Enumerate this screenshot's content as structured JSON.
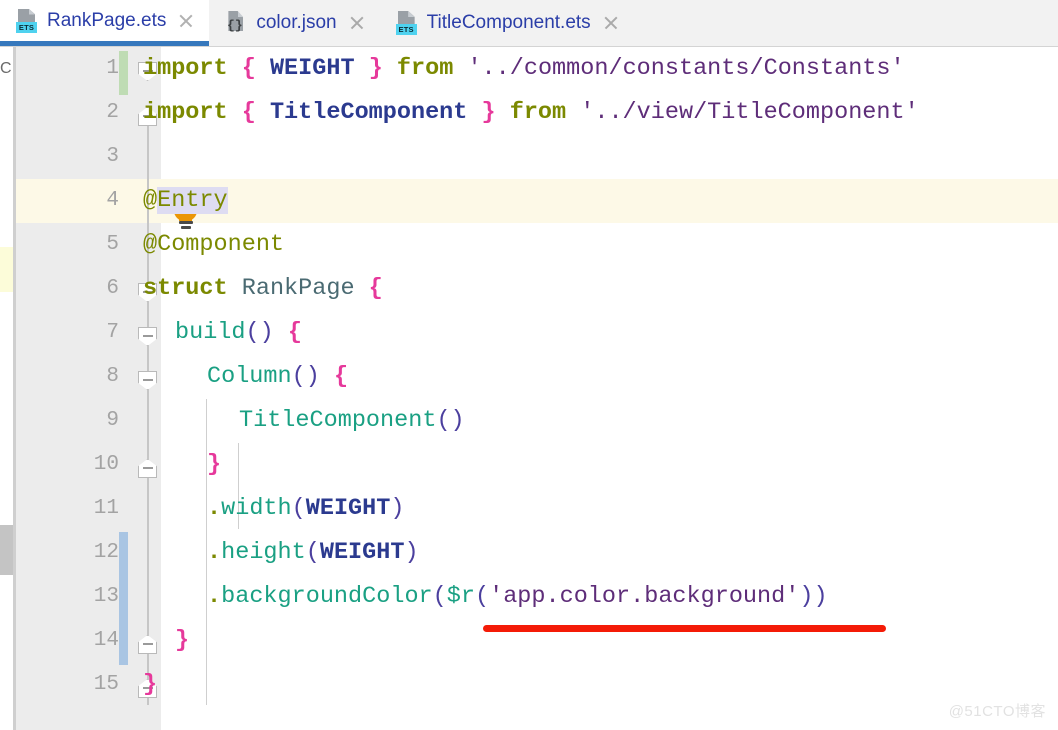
{
  "window": {
    "app": "DevEco Studio Editor",
    "watermark": "@51CTO博客"
  },
  "tab_bar": {
    "tabs": [
      {
        "label": "RankPage.ets",
        "icon": "ets-file-icon",
        "badge": "ETS",
        "active": true,
        "close_icon": "close-icon"
      },
      {
        "label": "color.json",
        "icon": "json-file-icon",
        "badge": "{}",
        "active": false,
        "close_icon": "close-icon"
      },
      {
        "label": "TitleComponent.ets",
        "icon": "ets-file-icon",
        "badge": "ETS",
        "active": false,
        "close_icon": "close-icon"
      }
    ],
    "active_tab_accent": "#3678bd"
  },
  "left_stripe": {
    "truncated_label": "C",
    "marker_icon": "bookmark-marker",
    "scrollbar_thumb": "vertical-scrollbar-thumb"
  },
  "editor": {
    "file": "RankPage.ets",
    "caret_line_number": 4,
    "selection_text": "Entry",
    "line_numbers": [
      "1",
      "2",
      "3",
      "4",
      "5",
      "6",
      "7",
      "8",
      "9",
      "10",
      "11",
      "12",
      "13",
      "14",
      "15"
    ],
    "lines": [
      {
        "n": 1,
        "text": "import { WEIGHT } from '../common/constants/Constants'"
      },
      {
        "n": 2,
        "text": "import { TitleComponent } from '../view/TitleComponent'"
      },
      {
        "n": 3,
        "text": ""
      },
      {
        "n": 4,
        "text": "@Entry"
      },
      {
        "n": 5,
        "text": "@Component"
      },
      {
        "n": 6,
        "text": "struct RankPage {"
      },
      {
        "n": 7,
        "text": "  build() {"
      },
      {
        "n": 8,
        "text": "    Column() {"
      },
      {
        "n": 9,
        "text": "      TitleComponent()"
      },
      {
        "n": 10,
        "text": "    }"
      },
      {
        "n": 11,
        "text": "    .width(WEIGHT)"
      },
      {
        "n": 12,
        "text": "    .height(WEIGHT)"
      },
      {
        "n": 13,
        "text": "    .backgroundColor($r('app.color.background'))"
      },
      {
        "n": 14,
        "text": "  }"
      },
      {
        "n": 15,
        "text": "}"
      }
    ],
    "tokens": {
      "import_kw": "import",
      "from_kw": "from",
      "struct_kw": "struct",
      "brace_open": "{",
      "brace_close": "}",
      "weight_ident": "WEIGHT",
      "title_component_ident": "TitleComponent",
      "constants_path": "'../common/constants/Constants'",
      "titlecomponent_path": "'../view/TitleComponent'",
      "entry_anno": "@",
      "entry_anno_name": "Entry",
      "component_anno": "@Component",
      "rankpage_type": "RankPage",
      "build_fn": "build",
      "column_fn": "Column",
      "titlecomponent_call": "TitleComponent",
      "paren_open": "(",
      "paren_close": ")",
      "dot": ".",
      "width_method": "width",
      "height_method": "height",
      "background_color_method": "backgroundColor",
      "resource_fn": "$r",
      "resource_string": "'app.color.background'"
    },
    "gutter": {
      "change_marker_added": "vcs-added-marker",
      "change_marker_modified": "vcs-modified-marker",
      "intention_bulb": "lightbulb-icon",
      "fold_icon": "code-fold-icon"
    },
    "annotation": {
      "type": "red-underline",
      "color": "#f41b07",
      "targets": "$r('app.color.background')"
    },
    "colors": {
      "keyword": "#7b8900",
      "brace": "#e6399b",
      "identifier": "#2b3a8f",
      "string": "#5e2d79",
      "function": "#1aa083",
      "paren": "#4b3f9e",
      "type": "#4a6a72",
      "caret_line_bg": "#fdf9e7",
      "selection_bg": "#dedcf2"
    }
  }
}
